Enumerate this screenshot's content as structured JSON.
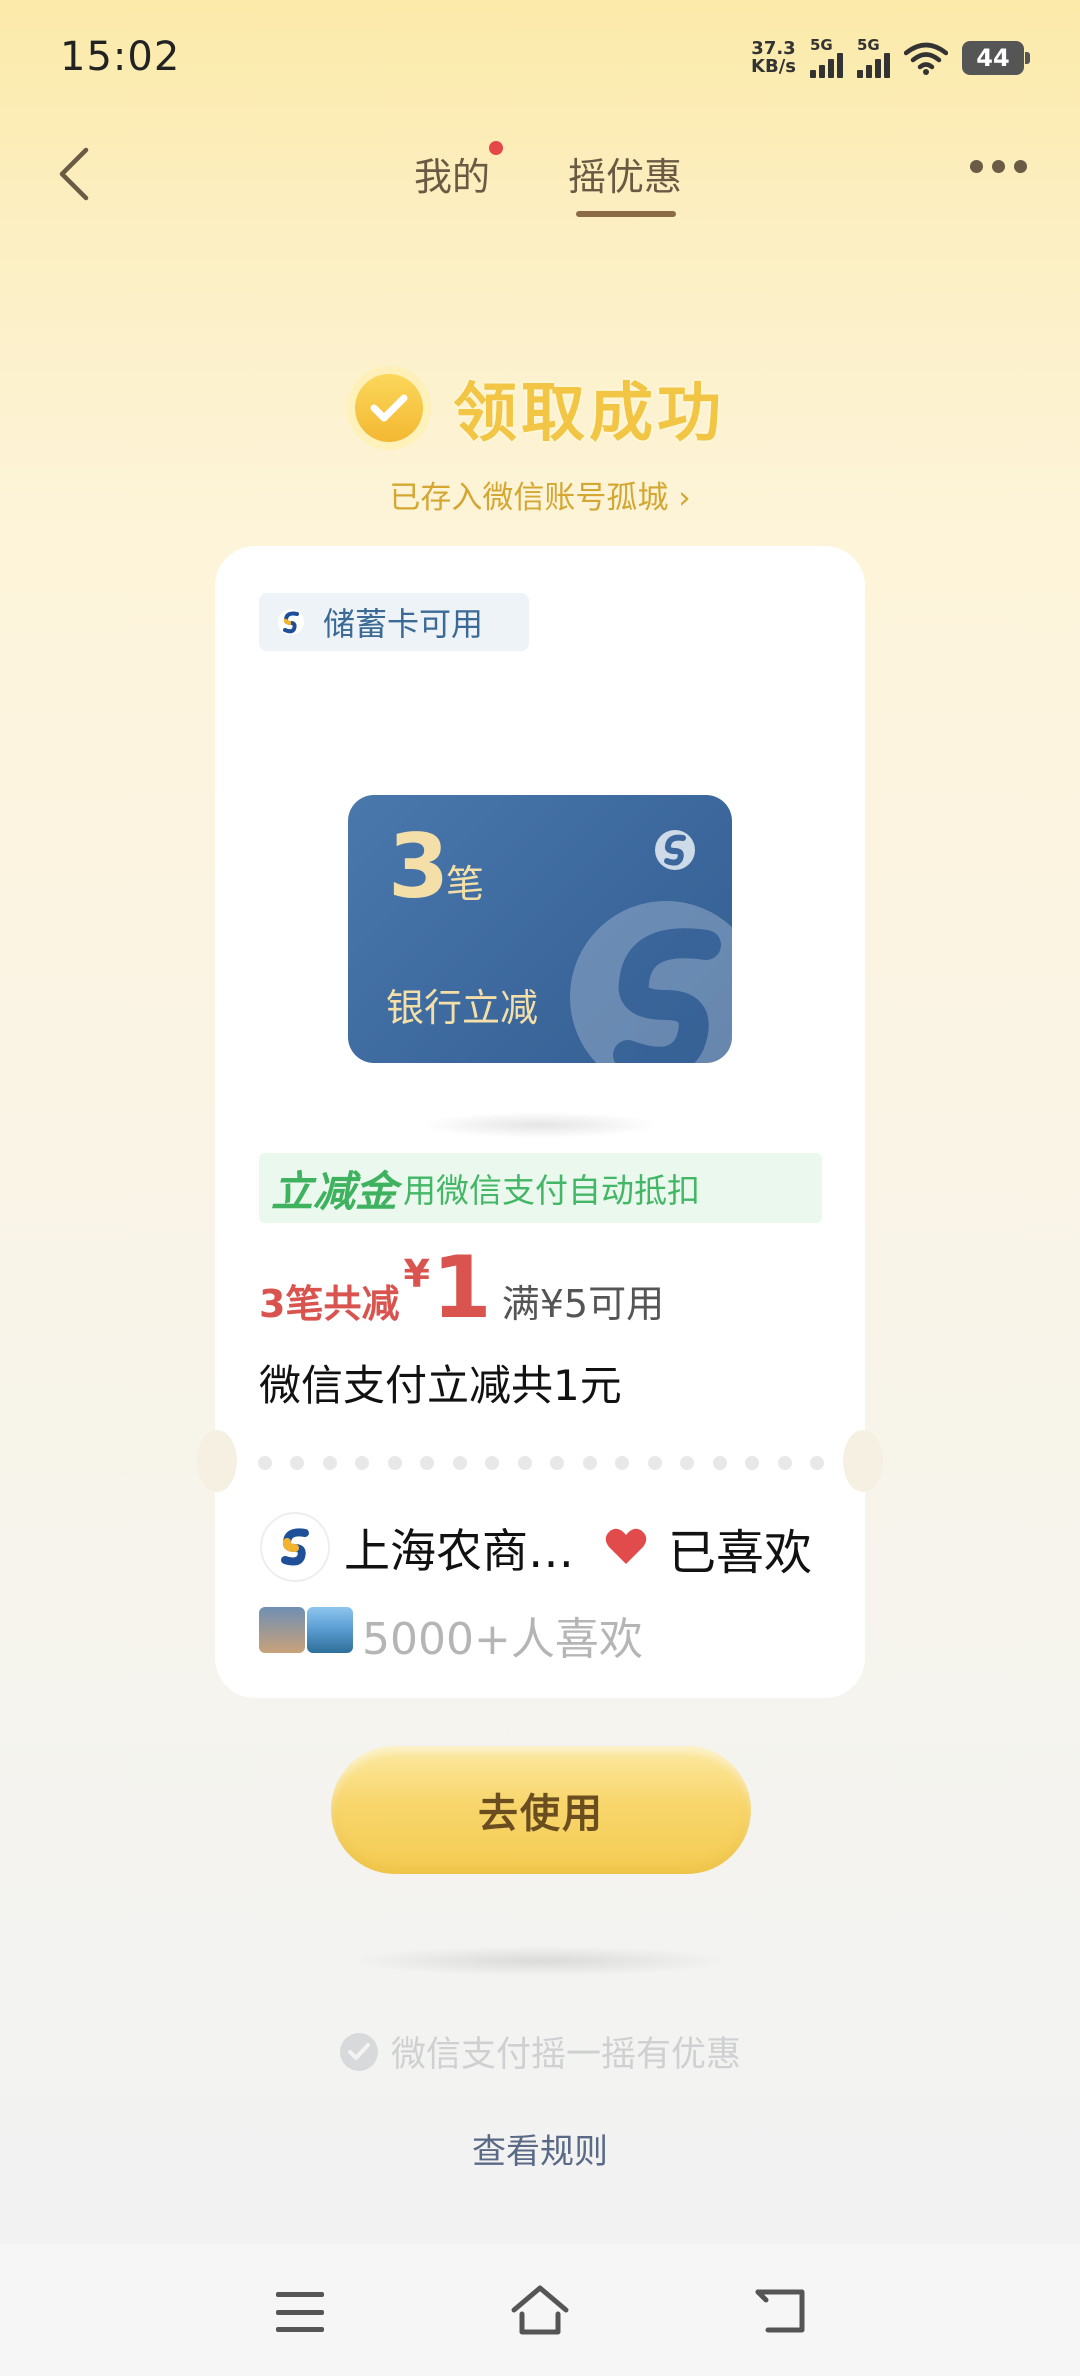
{
  "status_bar": {
    "time": "15:02",
    "net_speed_value": "37.3",
    "net_speed_unit": "KB/s",
    "sim1": "5G",
    "sim2": "5G",
    "battery": "44"
  },
  "nav": {
    "tab_mine": "我的",
    "tab_shake": "摇优惠",
    "active_tab": "摇优惠"
  },
  "success": {
    "title": "领取成功",
    "saved_to": "已存入微信账号孤城 ›"
  },
  "coupon": {
    "card_type_badge": "储蓄卡可用",
    "card_count": "3",
    "card_unit": "笔",
    "card_desc": "银行立减",
    "discount_label": "立减金",
    "discount_desc": "用微信支付自动抵扣",
    "amount_prefix": "3笔共减",
    "currency": "¥",
    "amount": "1",
    "condition": "满¥5可用",
    "summary": "微信支付立减共1元",
    "bank_name": "上海农商…",
    "liked_label": "已喜欢",
    "likes_count": "5000+人喜欢"
  },
  "actions": {
    "use_button": "去使用"
  },
  "footer": {
    "promo": "微信支付摇一摇有优惠",
    "rules": "查看规则"
  },
  "colors": {
    "accent_gold": "#f2c544",
    "discount_red": "#d9534f",
    "discount_green": "#3fb25f",
    "bank_blue": "#3b679c",
    "heart_red": "#e24b4b"
  }
}
